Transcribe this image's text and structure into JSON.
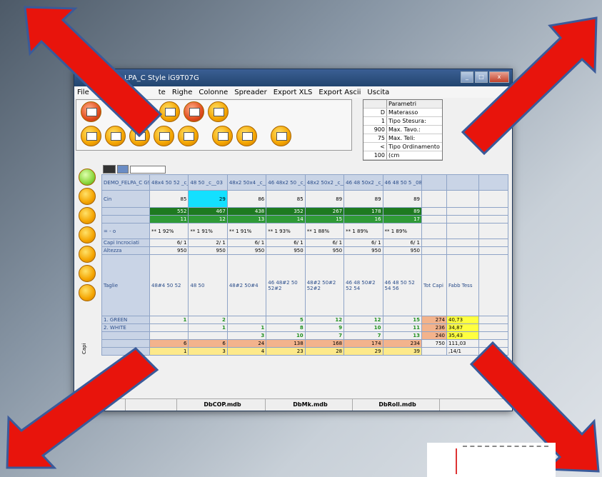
{
  "window": {
    "title": "LPA_C  Style iG9T07G"
  },
  "menu": [
    "File",
    "te",
    "Righe",
    "Colonne",
    "Spreader",
    "Export XLS",
    "Export Ascii",
    "Uscita"
  ],
  "params": {
    "header": "Parametri",
    "rows": [
      {
        "v": "D",
        "l": "Materasso"
      },
      {
        "v": "1",
        "l": "Tipo Stesura:"
      },
      {
        "v": "900",
        "l": "Max. Tavo.:"
      },
      {
        "v": "75",
        "l": "Max. Teli:"
      },
      {
        "v": "<",
        "l": "Tipo Ordinamento"
      },
      {
        "v": "100",
        "l": "(cm"
      }
    ]
  },
  "grid": {
    "model": "DEMO_FELPA_C\nG9T07G",
    "cols": [
      "48x4 50 52 _c__02",
      "48 50 _c__03",
      "48x2 50x4 _c__04",
      "46 48x2 50 _c__05",
      "48x2 50x2 _c__06",
      "46 48 50x2 _c__07",
      "46 48 50 5 _08_1"
    ],
    "cin": [
      "85",
      "29",
      "86",
      "85",
      "89",
      "89",
      "89"
    ],
    "green1": [
      "552",
      "467",
      "438",
      "352",
      "267",
      "178",
      "89"
    ],
    "green2": [
      "11",
      "12",
      "13",
      "14",
      "15",
      "16",
      "17"
    ],
    "eff_label": "= - o",
    "eff": [
      "** 1 92%",
      "** 1 91%",
      "** 1 91%",
      "** 1 93%",
      "** 1 88%",
      "** 1 89%",
      "** 1 89%"
    ],
    "capi_label": "Capi Incrociati",
    "capi": [
      "6/ 1",
      "2/ 1",
      "6/ 1",
      "6/ 1",
      "6/ 1",
      "6/ 1",
      "6/ 1"
    ],
    "alt_label": "Altezza",
    "alt": [
      "950",
      "950",
      "950",
      "950",
      "950",
      "950",
      "950"
    ],
    "taglie_label": "Taglie",
    "taglie": [
      "48#4 50 52",
      "48 50",
      "48#2 50#4",
      "46 48#2 50 52#2",
      "48#2 50#2 52#2",
      "46 48 50#2 52 54",
      "46 48 50 52 54 56"
    ],
    "tot_label": "Tot Capi",
    "fabb_label": "Fabb Tess",
    "colors": [
      {
        "name": "1. GREEN",
        "vals": [
          "1",
          "2",
          "",
          "5",
          "12",
          "12",
          "15"
        ],
        "tot": "274",
        "fabb": "40,73"
      },
      {
        "name": "2. WHITE",
        "vals": [
          "",
          "1",
          "1",
          "8",
          "9",
          "10",
          "11"
        ],
        "tot": "236",
        "fabb": "34,87"
      },
      {
        "name": "",
        "vals": [
          "",
          "",
          "3",
          "10",
          "7",
          "7",
          "13"
        ],
        "tot": "240",
        "fabb": "35,43"
      }
    ],
    "orange": [
      "6",
      "6",
      "24",
      "138",
      "168",
      "174",
      "234"
    ],
    "orange_tot": "750",
    "orange_fabb": "111,03",
    "yellow": [
      "1",
      "3",
      "4",
      "23",
      "28",
      "29",
      "39"
    ],
    "yellow_fabb": ",14/1",
    "side_label": "Capi"
  },
  "status": [
    "DbCOP.mdb",
    "DbMk.mdb",
    "DbRoll.mdb"
  ],
  "colors": {
    "arrow": "#e8140c",
    "arrow_border": "#3a5a9a"
  }
}
